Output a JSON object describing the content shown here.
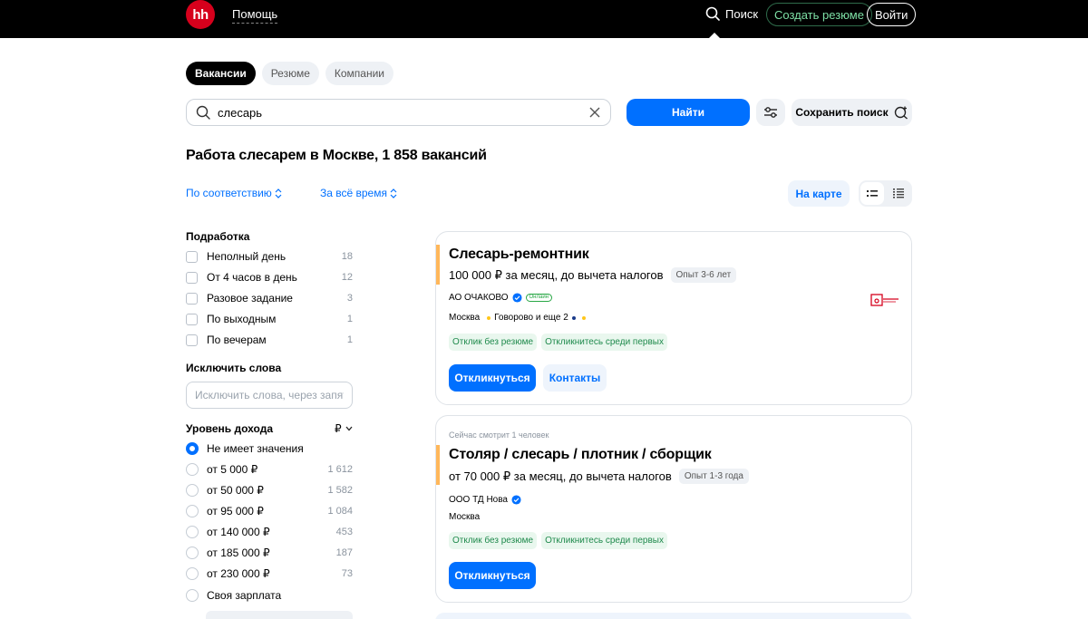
{
  "header": {
    "logo_text": "hh",
    "help_label": "Помощь",
    "search_label": "Поиск",
    "create_resume_label": "Создать резюме",
    "login_label": "Войти",
    "accent_color": "#d6001c"
  },
  "tabs": [
    {
      "label": "Вакансии",
      "active": true
    },
    {
      "label": "Резюме",
      "active": false
    },
    {
      "label": "Компании",
      "active": false
    }
  ],
  "search": {
    "value": "слесарь",
    "find_label": "Найти",
    "save_label": "Сохранить поиск"
  },
  "results": {
    "title": "Работа слесарем в Москве, 1 858 вакансий",
    "sort_label": "По соответствию",
    "period_label": "За всё время",
    "map_label": "На карте"
  },
  "filters": {
    "parttime_heading": "Подработка",
    "parttime": [
      {
        "label": "Неполный день",
        "count": "18"
      },
      {
        "label": "От 4 часов в день",
        "count": "12"
      },
      {
        "label": "Разовое задание",
        "count": "3"
      },
      {
        "label": "По выходным",
        "count": "1"
      },
      {
        "label": "По вечерам",
        "count": "1"
      }
    ],
    "exclude_heading": "Исключить слова",
    "exclude_placeholder": "Исключить слова, через запятую",
    "income_heading": "Уровень дохода",
    "currency": "₽",
    "income": [
      {
        "label": "Не имеет значения",
        "count": "",
        "selected": true
      },
      {
        "label": "от 5 000 ₽",
        "count": "1 612",
        "selected": false
      },
      {
        "label": "от 50 000 ₽",
        "count": "1 582",
        "selected": false
      },
      {
        "label": "от 95 000 ₽",
        "count": "1 084",
        "selected": false
      },
      {
        "label": "от 140 000 ₽",
        "count": "453",
        "selected": false
      },
      {
        "label": "от 185 000 ₽",
        "count": "187",
        "selected": false
      },
      {
        "label": "от 230 000 ₽",
        "count": "73",
        "selected": false
      },
      {
        "label": "Своя зарплата",
        "count": "",
        "selected": false
      }
    ]
  },
  "vacancies": [
    {
      "title": "Слесарь-ремонтник",
      "salary": "100 000 ₽ за месяц, до вычета налогов",
      "experience": "Опыт 3-6 лет",
      "company": "АО ОЧАКОВО",
      "online_badge": "Онлайн",
      "city": "Москва",
      "metro": "Говорово и еще 2",
      "chip_1": "Отклик без резюме",
      "chip_2": "Откликнитесь среди первых",
      "apply_label": "Откликнуться",
      "contacts_label": "Контакты",
      "metro_colors": [
        "#ffc61a",
        "#1a3a8a",
        "#ffc61a"
      ]
    },
    {
      "watching": "Сейчас смотрит 1 человек",
      "title": "Столяр / слесарь / плотник / сборщик",
      "salary": "от 70 000 ₽ за месяц, до вычета налогов",
      "experience": "Опыт 1-3 года",
      "company": "ООО ТД Нова",
      "city": "Москва",
      "chip_1": "Отклик без резюме",
      "chip_2": "Откликнитесь среди первых",
      "apply_label": "Откликнуться"
    }
  ],
  "colors": {
    "primary": "#0070ff",
    "chip_green": "#1f8a4c",
    "card_accent": "#ffb75a"
  }
}
